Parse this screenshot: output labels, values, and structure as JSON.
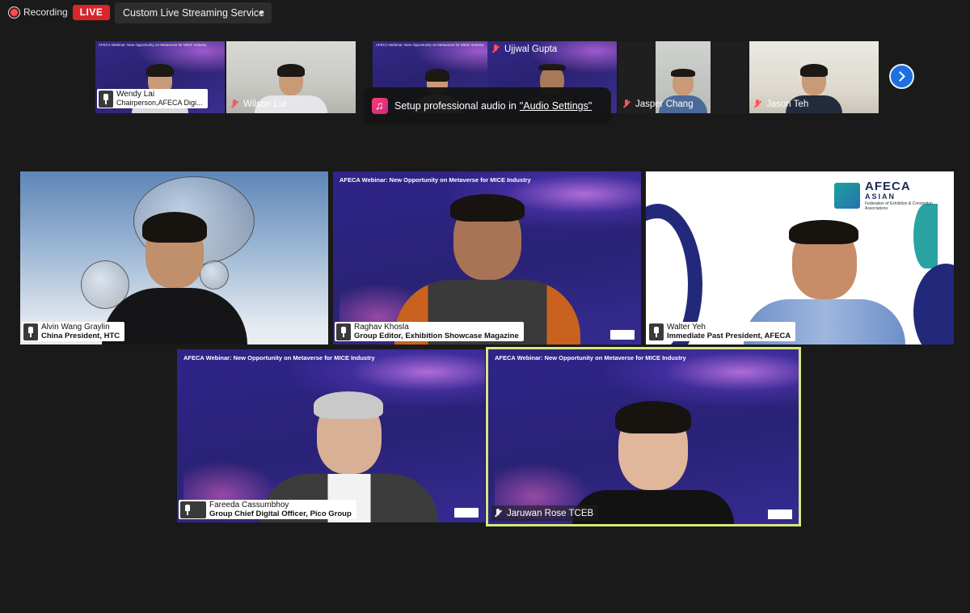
{
  "topbar": {
    "recording_label": "Recording",
    "live_label": "LIVE",
    "stream_service_label": "Custom Live Streaming Service"
  },
  "thumbnails": [
    {
      "name": "Wendy Lai",
      "subtitle": "Chairperson,AFECA  Digi...",
      "boxed": true,
      "background": "webinar"
    },
    {
      "name": "Wilson Lui",
      "boxed": false,
      "background": "office"
    },
    {
      "name": "",
      "boxed": false,
      "background": "webinar"
    },
    {
      "name": "Ujjwal Gupta",
      "boxed": false,
      "background": "webinar"
    },
    {
      "name": "Jasper Chang",
      "boxed": false,
      "background": "dark"
    },
    {
      "name": "Jason Teh",
      "boxed": false,
      "background": "office2"
    }
  ],
  "tooltip": {
    "text": "Setup professional audio in",
    "link": "\"Audio Settings\""
  },
  "banner_text": "AFECA Webinar: New Opportunity on Metaverse for MICE Industry",
  "gallery": [
    {
      "name": "Alvin Wang Graylin",
      "title": "China President, HTC"
    },
    {
      "name": "Raghav Khosla",
      "title": "Group Editor, Exhibition Showcase Magazine"
    },
    {
      "name": "Walter Yeh",
      "title": "Immediate Past President, AFECA"
    },
    {
      "name": "Fareeda Cassumbhoy",
      "title": "Group Chief Digital Officer, Pico Group"
    },
    {
      "name": "Jaruwan Rose TCEB",
      "title": ""
    }
  ],
  "afeca_logo": {
    "line1": "AFECA",
    "line2": "ASIAN",
    "line3": "Federation of Exhibition & Convention Associations"
  },
  "colors": {
    "live": "#d9252b",
    "active_speaker_border": "#d7e87a",
    "next_button": "#1e6fe0",
    "muted_mic": "#ff5353"
  }
}
